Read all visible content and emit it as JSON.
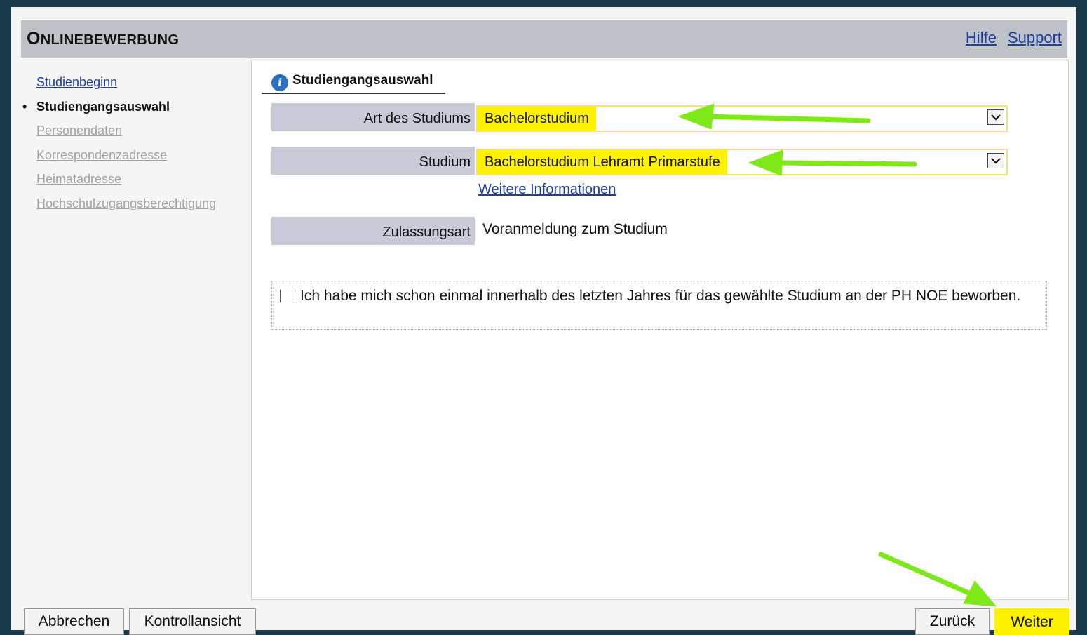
{
  "header": {
    "title_first": "O",
    "title_rest": "NLINEBEWERBUNG",
    "links": {
      "help": "Hilfe",
      "support": "Support"
    }
  },
  "sidebar": {
    "bullet": "•",
    "items": [
      {
        "label": "Studienbeginn",
        "state": "link"
      },
      {
        "label": "Studiengangsauswahl",
        "state": "active"
      },
      {
        "label": "Personendaten",
        "state": "disabled"
      },
      {
        "label": "Korrespondenzadresse",
        "state": "disabled"
      },
      {
        "label": "Heimatadresse",
        "state": "disabled"
      },
      {
        "label": "Hochschulzugangsberechtigung",
        "state": "disabled"
      }
    ]
  },
  "main": {
    "section_icon": "info-icon",
    "section_icon_glyph": "i",
    "section_title": "Studiengangsauswahl",
    "fields": {
      "art": {
        "label": "Art des Studiums",
        "value": "Bachelorstudium"
      },
      "studium": {
        "label": "Studium",
        "value": "Bachelorstudium Lehramt Primarstufe"
      },
      "more_info": "Weitere Informationen",
      "zulassung": {
        "label": "Zulassungsart",
        "value": "Voranmeldung zum Studium"
      }
    },
    "checkbox": {
      "checked": false,
      "text": "Ich habe mich schon einmal innerhalb des letzten Jahres für das gewählte Studium an der PH NOE beworben."
    }
  },
  "footer": {
    "cancel": "Abbrechen",
    "preview": "Kontrollansicht",
    "back": "Zurück",
    "next": "Weiter"
  },
  "colors": {
    "background": "#1a3a4c",
    "header_bar": "#bfc3c8",
    "label_bg": "#c8cad8",
    "highlight": "#fff200",
    "link": "#1c3fa6",
    "annotation_arrow": "#7ee81a"
  }
}
